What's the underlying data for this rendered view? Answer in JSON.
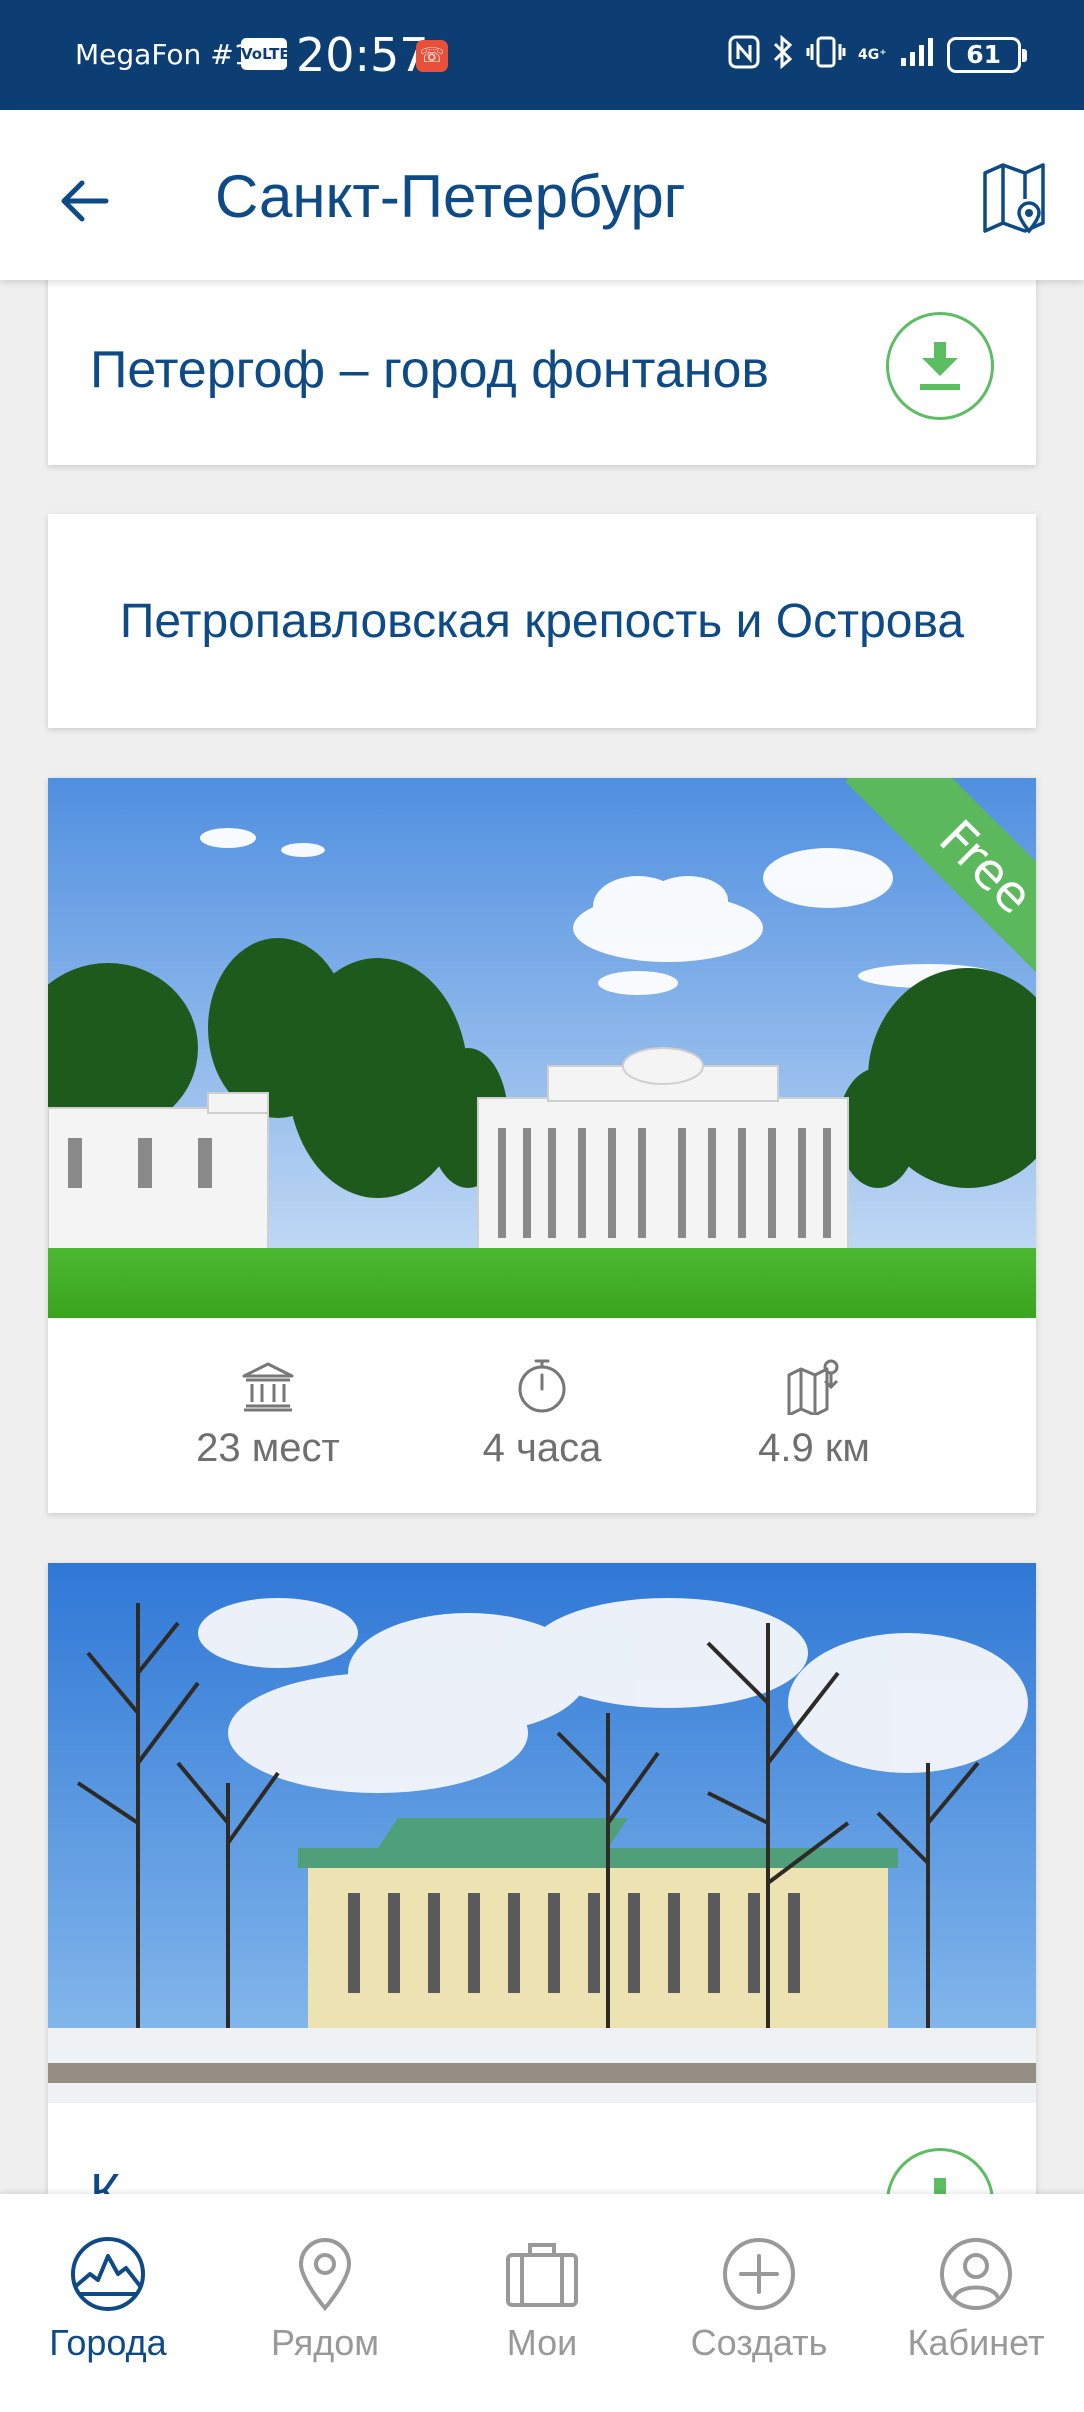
{
  "status_bar": {
    "carrier": "MegaFon #1",
    "volte": "VoLTE",
    "time": "20:57",
    "network": "4G⁺",
    "battery": "61"
  },
  "header": {
    "title": "Санкт-Петербург"
  },
  "routes": [
    {
      "title": "Петергоф – город фонтанов"
    },
    {
      "title": "Петропавловская крепость и Острова"
    },
    {
      "badge": "Free",
      "stats": {
        "places": "23 мест",
        "duration": "4 часа",
        "distance": "4.9 км"
      }
    },
    {
      "title": "К..."
    }
  ],
  "bottom_nav": [
    {
      "label": "Города",
      "icon": "cities-icon",
      "active": true
    },
    {
      "label": "Рядом",
      "icon": "location-pin-icon",
      "active": false
    },
    {
      "label": "Мои",
      "icon": "suitcase-icon",
      "active": false
    },
    {
      "label": "Создать",
      "icon": "plus-circle-icon",
      "active": false
    },
    {
      "label": "Кабинет",
      "icon": "user-icon",
      "active": false
    }
  ],
  "colors": {
    "status_bar_bg": "#0c3d73",
    "brand_blue": "#0d4a86",
    "accent_green": "#5cbd62",
    "inactive_gray": "#999999"
  }
}
